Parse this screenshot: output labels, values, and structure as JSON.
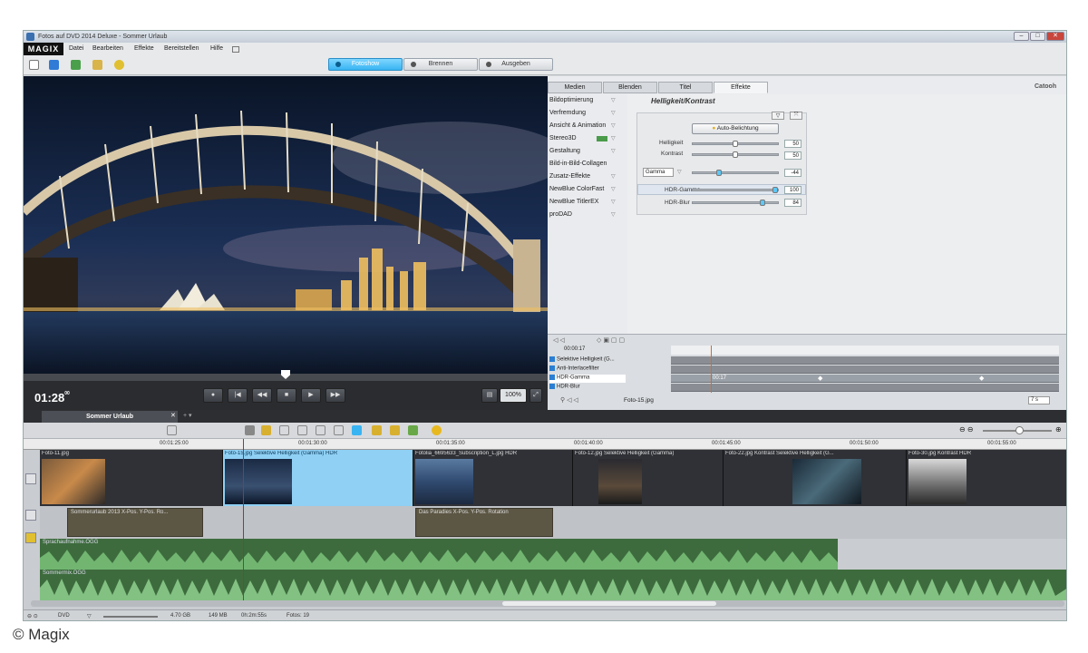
{
  "window": {
    "title": "Fotos auf DVD 2014 Deluxe - Sommer Urlaub",
    "minimize": "–",
    "maximize": "□",
    "close": "✕"
  },
  "menu": {
    "logo": "MAGIX",
    "items": [
      "Datei",
      "Bearbeiten",
      "Effekte",
      "Bereitstellen",
      "Hilfe"
    ]
  },
  "modes": {
    "slideshow": "Fotoshow",
    "burn": "Brennen",
    "output": "Ausgeben"
  },
  "player": {
    "timecode": "01:28",
    "frames": "00",
    "zoom": "100%"
  },
  "tabs": [
    "Medien",
    "Blenden",
    "Titel",
    "Effekte"
  ],
  "brand": "Catooh",
  "effects": [
    "Bildoptimierung",
    "Verfremdung",
    "Ansicht & Animation",
    "Stereo3D",
    "Gestaltung",
    "Bild-in-Bild-Collagen",
    "Zusatz-Effekte",
    "NewBlue ColorFast",
    "NewBlue TitlerEX",
    "proDAD"
  ],
  "panel": {
    "title": "Helligkeit/Kontrast",
    "auto_button": "Auto-Belichtung",
    "brightness_label": "Helligkeit",
    "brightness": "50",
    "contrast_label": "Kontrast",
    "contrast": "50",
    "gamma_select": "Gamma",
    "gamma": "-44",
    "hdr_gamma_label": "HDR-Gamma",
    "hdr_gamma": "100",
    "hdr_blur_label": "HDR-Blur",
    "hdr_blur": "84"
  },
  "keyframes": {
    "time": "00:00:17",
    "rows": [
      "Selektive Helligkeit (G...",
      "Anti-Interlacefilter",
      "HDR-Gamma",
      "HDR-Blur"
    ],
    "marker": "00:17",
    "file": "Foto-15.jpg",
    "zoom": "7 s"
  },
  "timeline": {
    "tab": "Sommer Urlaub",
    "ruler": [
      "00:01:25:00",
      "00:01:30:00",
      "00:01:35:00",
      "00:01:40:00",
      "00:01:45:00",
      "00:01:50:00",
      "00:01:55:00"
    ],
    "clips": [
      "Foto-11.jpg",
      "Foto-15.jpg   Selektive Helligkeit (Gamma)   HDR",
      "Fotolia_6695633_Subscription_L.jpg   HDR",
      "Foto-12.jpg   Selektive Helligkeit (Gamma)",
      "Foto-22.jpg   Kontrast   Selektive Helligkeit (G...",
      "Foto-30.jpg   Kontrast   HDR"
    ],
    "titles": [
      "Sommerurlaub 2013   X-Pos.   Y-Pos.   Ro...",
      "Das Paradies   X-Pos.   Y-Pos.   Rotation"
    ],
    "audio1": "Sprachaufnahme.OGG",
    "audio2": "Sommermix.OGG"
  },
  "status": {
    "disc": "DVD",
    "capacity": "4.70 GB",
    "used": "149 MB",
    "duration": "0h:2m:55s",
    "photos": "Fotos: 19"
  },
  "copyright": "© Magix",
  "colors": {
    "accent": "#38b4f2",
    "audio": "#3d6b3d",
    "playhead": "#e11111"
  }
}
